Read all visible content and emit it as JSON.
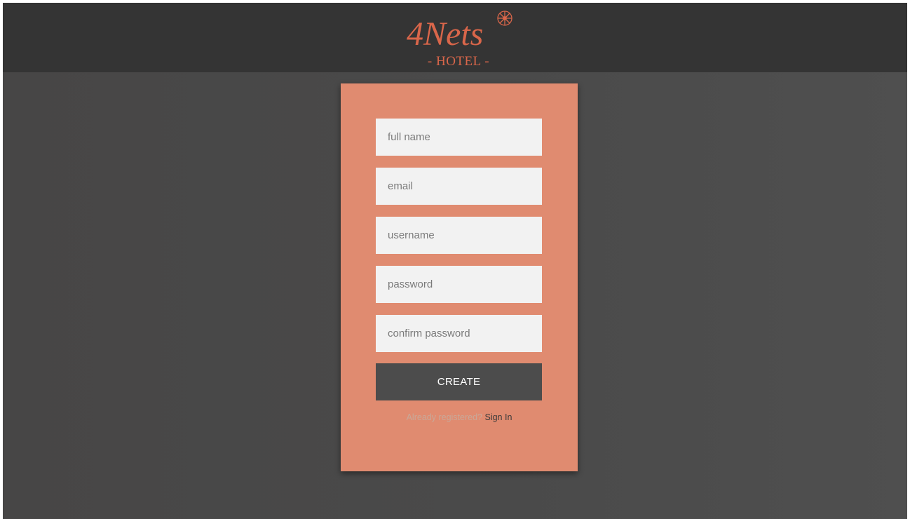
{
  "header": {
    "logo": {
      "brand": "4Nets",
      "subtitle": "- HOTEL -",
      "icon": "compass-rose-icon",
      "color": "#d9664a"
    }
  },
  "form": {
    "fields": {
      "full_name": {
        "placeholder": "full name",
        "value": ""
      },
      "email": {
        "placeholder": "email",
        "value": ""
      },
      "username": {
        "placeholder": "username",
        "value": ""
      },
      "password": {
        "placeholder": "password",
        "value": ""
      },
      "confirm_password": {
        "placeholder": "confirm password",
        "value": ""
      }
    },
    "submit_label": "CREATE",
    "already_registered_text": "Already registered?",
    "signin_link_label": "Sign In"
  },
  "colors": {
    "header_bg": "#343434",
    "page_bg": "#4a4a4a",
    "card_bg": "#e08b70",
    "input_bg": "#f2f2f2",
    "button_bg": "#4c4c4c",
    "accent": "#d9664a"
  }
}
